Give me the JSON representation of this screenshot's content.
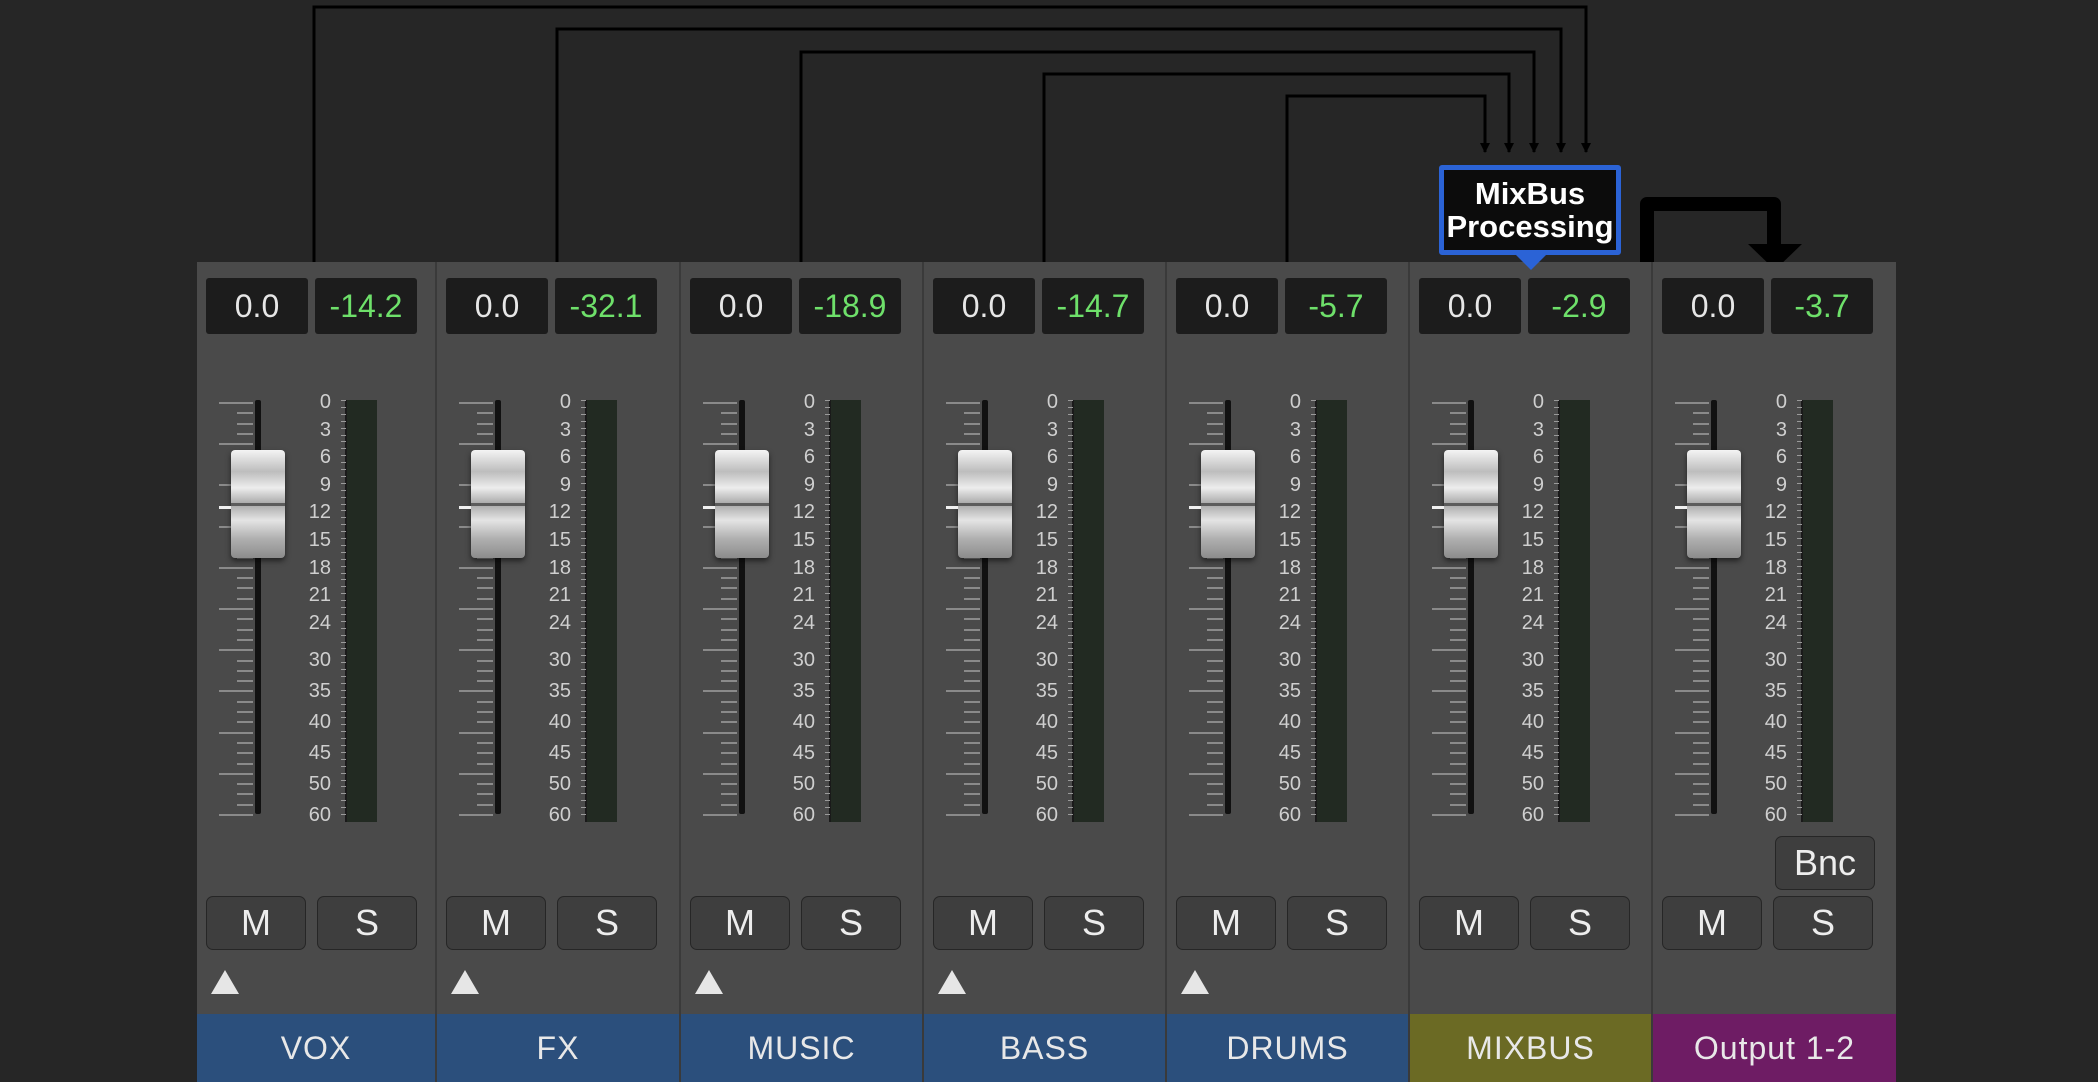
{
  "colors": {
    "background": "#262626",
    "strip_bg": "#4a4a4a",
    "value_box_bg": "#1c1c1c",
    "peak_green": "#6ee06a",
    "bus_blue": "#2b63d6"
  },
  "routing_label": {
    "line1": "MixBus",
    "line2": "Processing"
  },
  "fader_scale": [
    "0",
    "3",
    "6",
    "9",
    "12",
    "15",
    "18",
    "21",
    "24",
    "30",
    "35",
    "40",
    "45",
    "50",
    "60"
  ],
  "channels": [
    {
      "name": "VOX",
      "volume": "0.0",
      "peak": "-14.2",
      "mute": "M",
      "solo": "S",
      "color": "#2b4f7c",
      "has_send": true,
      "has_bounce": false,
      "routes_to_mixbus": true
    },
    {
      "name": "FX",
      "volume": "0.0",
      "peak": "-32.1",
      "mute": "M",
      "solo": "S",
      "color": "#2b4f7c",
      "has_send": true,
      "has_bounce": false,
      "routes_to_mixbus": true
    },
    {
      "name": "MUSIC",
      "volume": "0.0",
      "peak": "-18.9",
      "mute": "M",
      "solo": "S",
      "color": "#2b4f7c",
      "has_send": true,
      "has_bounce": false,
      "routes_to_mixbus": true
    },
    {
      "name": "BASS",
      "volume": "0.0",
      "peak": "-14.7",
      "mute": "M",
      "solo": "S",
      "color": "#2b4f7c",
      "has_send": true,
      "has_bounce": false,
      "routes_to_mixbus": true
    },
    {
      "name": "DRUMS",
      "volume": "0.0",
      "peak": "-5.7",
      "mute": "M",
      "solo": "S",
      "color": "#2b4f7c",
      "has_send": true,
      "has_bounce": false,
      "routes_to_mixbus": true
    },
    {
      "name": "MIXBUS",
      "volume": "0.0",
      "peak": "-2.9",
      "mute": "M",
      "solo": "S",
      "color": "#6b6a24",
      "has_send": false,
      "has_bounce": false,
      "routes_to_mixbus": false
    },
    {
      "name": "Output 1-2",
      "volume": "0.0",
      "peak": "-3.7",
      "mute": "M",
      "solo": "S",
      "color": "#6e1c64",
      "has_send": false,
      "has_bounce": true,
      "bounce_label": "Bnc",
      "routes_to_mixbus": false
    }
  ]
}
